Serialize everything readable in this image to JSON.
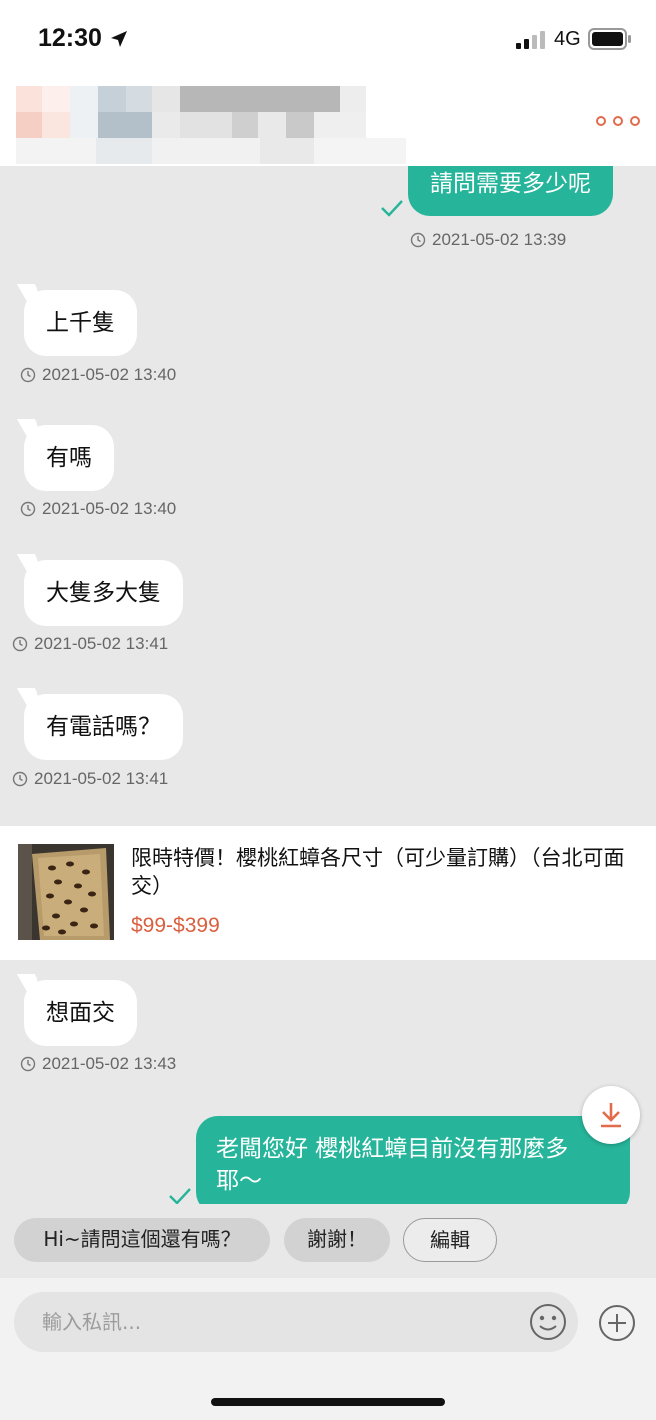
{
  "status_bar": {
    "time": "12:30",
    "network": "4G"
  },
  "header": {
    "menu_icon": "more-dots-icon"
  },
  "messages": [
    {
      "direction": "out",
      "text": "請問需要多少呢",
      "timestamp": "2021-05-02 13:39",
      "read": true
    },
    {
      "direction": "in",
      "text": "上千隻",
      "timestamp": "2021-05-02 13:40"
    },
    {
      "direction": "in",
      "text": "有嗎",
      "timestamp": "2021-05-02 13:40"
    },
    {
      "direction": "in",
      "text": "大隻多大隻",
      "timestamp": "2021-05-02 13:41"
    },
    {
      "direction": "in",
      "text": "有電話嗎？",
      "timestamp": "2021-05-02 13:41"
    },
    {
      "direction": "in",
      "text": "想面交",
      "timestamp": "2021-05-02 13:43"
    },
    {
      "direction": "out",
      "text_line1": "老闆您好 櫻桃紅蟑目前沒有那麼多",
      "text_line2": "耶～",
      "read": true
    }
  ],
  "product": {
    "title": "限時特價！櫻桃紅蟑各尺寸（可少量訂購）（台北可面交）",
    "price": "$99-$399"
  },
  "quick_replies": [
    "Hi~請問這個還有嗎？",
    "謝謝！",
    "編輯"
  ],
  "composer": {
    "placeholder": "輸入私訊..."
  },
  "colors": {
    "accent": "#26b59a",
    "price": "#d9603f",
    "menu": "#e26b4c"
  }
}
